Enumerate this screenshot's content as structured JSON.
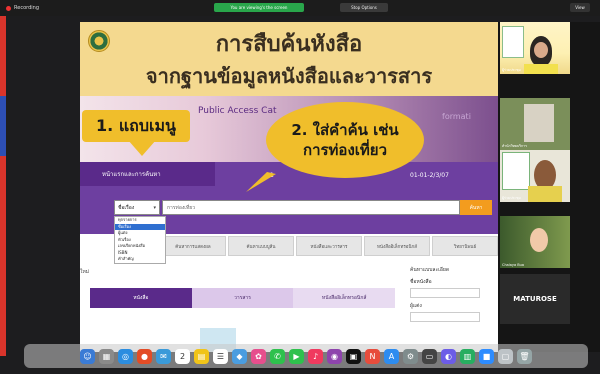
{
  "top_bar": {
    "recording_label": "Recording",
    "share_notice": "You are viewing's the screen",
    "stop_share_label": "Stop Options",
    "view_label": "View"
  },
  "page": {
    "title_line1": "การสืบค้นหังสือ",
    "title_line2": "จากฐานข้อมูลหนังสือและวารสาร",
    "opac_label": "Public Access Cat",
    "info_label": "formati",
    "nav_tab1": "หน้าแรกและการค้นหา",
    "nav_mid": "1",
    "nav_right": "01-01-2/3/07"
  },
  "callouts": {
    "c1": "1. แถบเมนู",
    "c2_line1": "2. ใส่คำค้น เช่น",
    "c2_line2": "การท่องเที่ยว"
  },
  "search": {
    "field_value": "ชื่อเรื่อง",
    "input_value": "การท่องเที่ยว",
    "button_label": "ค้นหา",
    "dropdown_options": [
      "ทุกรายการ",
      "ชื่อเรื่อง",
      "ผู้แต่ง",
      "หัวเรื่อง",
      "เลขเรียกหนังสือ",
      "ISBN",
      "คำสำคัญ"
    ],
    "selected_index": 1
  },
  "tabs": [
    "ค้นหาการแสดงผล",
    "ค้นหาแบบบูลีน",
    "หนังสือและวารสาร",
    "หนังสืออิเล็กทรอนิกส์",
    "วิทยานิพนธ์"
  ],
  "left_label": "ใหม่",
  "results_tabs": [
    "หนังสือ",
    "วารสาร",
    "หนังสืออิเล็กทรอนิกส์"
  ],
  "aside": {
    "heading": "ค้นหาแบบละเอียด",
    "field1": "ชื่อหนังสือ",
    "field2": "ผู้แต่ง"
  },
  "participants": {
    "p1": "ผู้ร่วมประชุม",
    "p2": "สำนักวิทยบริการ",
    "p3": "ผู้ร่วมประชุม",
    "p4": "Chalaya Bua",
    "p5": "MATUROSE"
  },
  "colors": {
    "banner": "#f4d98f",
    "nav_purple": "#6d3fa0",
    "callout_yellow": "#f0be2b",
    "search_orange": "#f39c1e"
  }
}
